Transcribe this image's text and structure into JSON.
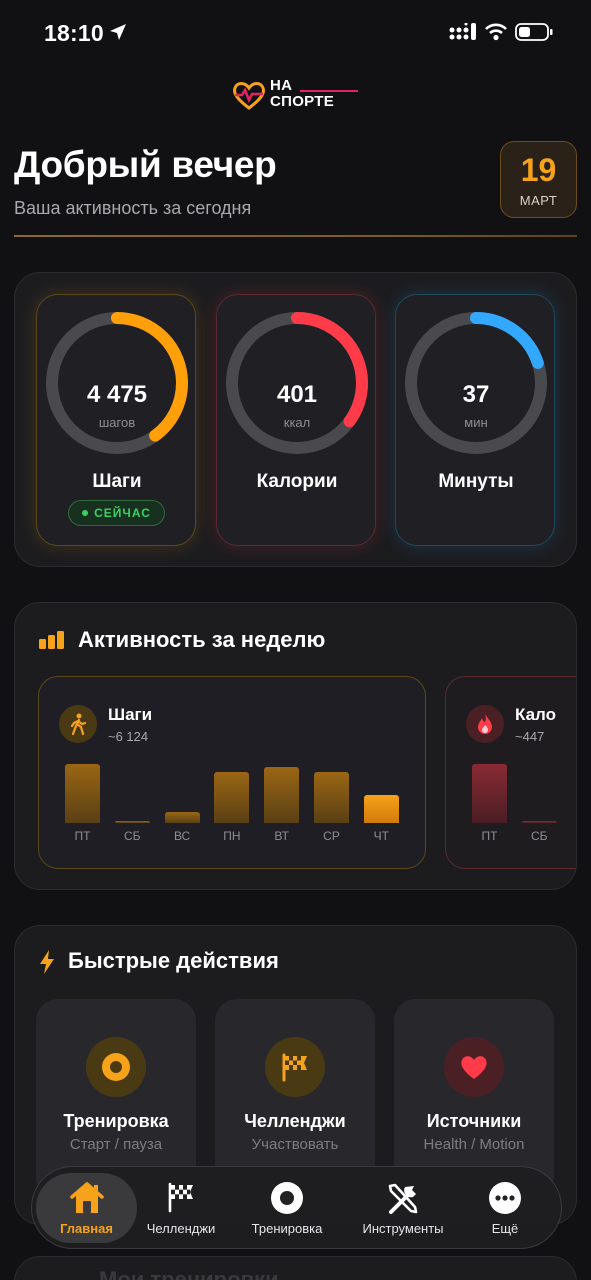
{
  "status": {
    "time": "18:10"
  },
  "logo": {
    "line1": "НА",
    "line2": "СПОРТЕ"
  },
  "header": {
    "greeting": "Добрый вечер",
    "subtitle": "Ваша активность за сегодня",
    "date_day": "19",
    "date_month": "МАРТ"
  },
  "rings": [
    {
      "value": "4 475",
      "unit": "шагов",
      "label": "Шаги",
      "progress": 0.4,
      "color": "#ff9f0a"
    },
    {
      "value": "401",
      "unit": "ккал",
      "label": "Калории",
      "progress": 0.35,
      "color": "#ff3b4a"
    },
    {
      "value": "37",
      "unit": "мин",
      "label": "Минуты",
      "progress": 0.2,
      "color": "#32a8ff"
    }
  ],
  "now_badge": "СЕЙЧАС",
  "week": {
    "title": "Активность за неделю",
    "steps": {
      "name": "Шаги",
      "avg": "~6 124",
      "color": "#f7a21b",
      "days": [
        "ПТ",
        "СБ",
        "ВС",
        "ПН",
        "ВТ",
        "СР",
        "ЧТ"
      ],
      "values": [
        0.95,
        0.04,
        0.17,
        0.82,
        0.9,
        0.82,
        0.45
      ]
    },
    "calories": {
      "name": "Кало",
      "avg": "~447",
      "color": "#ff3b4a",
      "days": [
        "ПТ",
        "СБ"
      ],
      "values": [
        0.95,
        0.0
      ]
    }
  },
  "quick": {
    "title": "Быстрые действия",
    "items": [
      {
        "name": "Тренировка",
        "sub": "Старт / пауза"
      },
      {
        "name": "Челленджи",
        "sub": "Участвовать"
      },
      {
        "name": "Источники",
        "sub": "Health / Motion"
      }
    ]
  },
  "peek_title": "Мои тренировки",
  "tabs": [
    {
      "label": "Главная"
    },
    {
      "label": "Челленджи"
    },
    {
      "label": "Тренировка"
    },
    {
      "label": "Инструменты"
    },
    {
      "label": "Ещё"
    }
  ]
}
